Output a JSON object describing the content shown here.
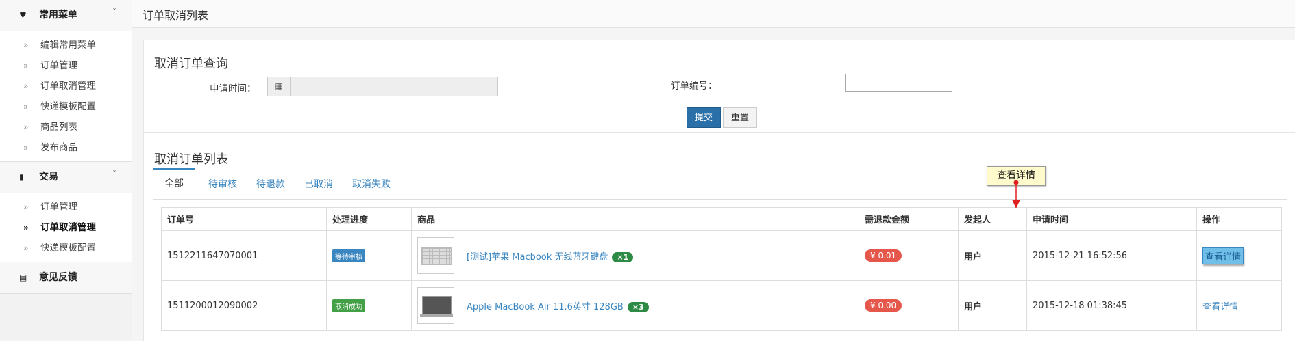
{
  "sidebar": {
    "group1": {
      "label": "常用菜单",
      "icon": "heart-icon"
    },
    "group1_items": [
      "编辑常用菜单",
      "订单管理",
      "订单取消管理",
      "快递模板配置",
      "商品列表",
      "发布商品"
    ],
    "group2": {
      "label": "交易",
      "icon": "bar-chart-icon"
    },
    "group2_items": [
      "订单管理",
      "订单取消管理",
      "快递模板配置"
    ],
    "group3": {
      "label": "意见反馈",
      "icon": "document-icon"
    }
  },
  "header": {
    "title": "订单取消列表"
  },
  "search": {
    "title": "取消订单查询",
    "apply_time_label": "申请时间：",
    "apply_time_value": "",
    "order_no_label": "订单编号：",
    "order_no_value": "",
    "submit_label": "提交",
    "reset_label": "重置"
  },
  "list": {
    "title": "取消订单列表",
    "tabs": [
      "全部",
      "待审核",
      "待退款",
      "已取消",
      "取消失败"
    ],
    "active_tab": "全部",
    "columns": [
      "订单号",
      "处理进度",
      "商品",
      "需退款金额",
      "发起人",
      "申请时间",
      "操作"
    ],
    "rows": [
      {
        "order_no": "1512211647070001",
        "status": "等待审核",
        "product": "[测试]苹果 Macbook 无线蓝牙键盘",
        "qty": "×1",
        "amount": "¥ 0.01",
        "initiator": "用户",
        "time": "2015-12-21 16:52:56",
        "action": "查看详情"
      },
      {
        "order_no": "1511200012090002",
        "status": "取消成功",
        "product": "Apple MacBook Air 11.6英寸 128GB",
        "qty": "×3",
        "amount": "¥ 0.00",
        "initiator": "用户",
        "time": "2015-12-18 01:38:45",
        "action": "查看详情"
      }
    ]
  },
  "tooltip": {
    "text": "查看详情"
  },
  "colors": {
    "accent": "#3a86c0",
    "primary_button": "#2a6fa8",
    "amount_badge": "#e4574a",
    "qty_badge": "#2e8b45",
    "status_wait": "#3a86c0",
    "status_done": "#43a047"
  }
}
